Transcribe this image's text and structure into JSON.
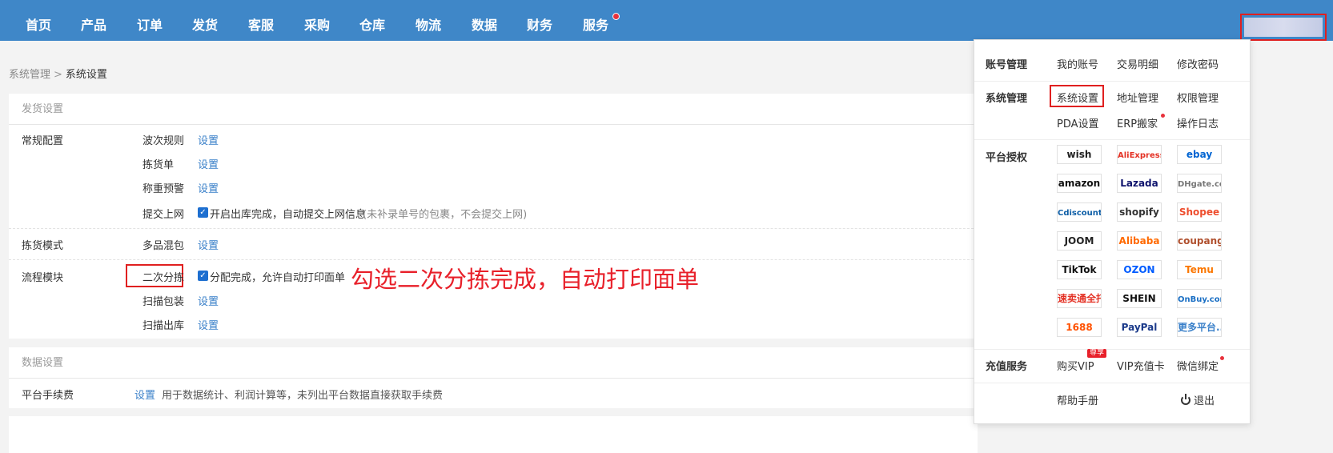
{
  "nav": {
    "items": [
      "首页",
      "产品",
      "订单",
      "发货",
      "客服",
      "采购",
      "仓库",
      "物流",
      "数据",
      "财务",
      "服务"
    ]
  },
  "breadcrumb": {
    "parent": "系统管理",
    "separator": ">",
    "current": "系统设置"
  },
  "shipping": {
    "header": "发货设置",
    "general": {
      "label": "常规配置",
      "items": [
        {
          "name": "波次规则",
          "action": "设置"
        },
        {
          "name": "拣货单",
          "action": "设置"
        },
        {
          "name": "称重预警",
          "action": "设置"
        }
      ],
      "submit": {
        "name": "提交上网",
        "checkbox_text": "开启出库完成，自动提交上网信息",
        "note": "(未补录单号的包裹，不会提交上网)"
      }
    },
    "picking": {
      "label": "拣货模式",
      "item": "多品混包",
      "action": "设置"
    },
    "flow": {
      "label": "流程模块",
      "sorting": {
        "name": "二次分拣",
        "checkbox_text": "分配完成，允许自动打印面单"
      },
      "items": [
        {
          "name": "扫描包装",
          "action": "设置"
        },
        {
          "name": "扫描出库",
          "action": "设置"
        }
      ]
    }
  },
  "annotation": "勾选二次分拣完成，自动打印面单",
  "data_settings": {
    "header": "数据设置",
    "fee": {
      "label": "平台手续费",
      "action": "设置",
      "desc": "用于数据统计、利润计算等，未列出平台数据直接获取手续费"
    }
  },
  "dropdown": {
    "account": {
      "label": "账号管理",
      "links": [
        "我的账号",
        "交易明细",
        "修改密码"
      ]
    },
    "system": {
      "label": "系统管理",
      "links": [
        "系统设置",
        "地址管理",
        "权限管理",
        "PDA设置",
        "ERP搬家",
        "操作日志"
      ]
    },
    "platforms": {
      "label": "平台授权",
      "logos": [
        {
          "name": "wish",
          "color": "#222222"
        },
        {
          "name": "AliExpress",
          "color": "#e43225"
        },
        {
          "name": "ebay",
          "color": "#0064d2"
        },
        {
          "name": "amazon",
          "color": "#111111"
        },
        {
          "name": "Lazada",
          "color": "#0f146d"
        },
        {
          "name": "DHgate.com",
          "color": "#777777"
        },
        {
          "name": "Cdiscount",
          "color": "#0d5ea6"
        },
        {
          "name": "shopify",
          "color": "#333333"
        },
        {
          "name": "Shopee",
          "color": "#ee4d2d"
        },
        {
          "name": "JOOM",
          "color": "#222222"
        },
        {
          "name": "Alibaba",
          "color": "#ff6a00"
        },
        {
          "name": "coupang",
          "color": "#b0502e"
        },
        {
          "name": "TikTok",
          "color": "#111111"
        },
        {
          "name": "OZON",
          "color": "#005bff"
        },
        {
          "name": "Temu",
          "color": "#fb7701"
        },
        {
          "name": "速卖通全托管",
          "color": "#e43225"
        },
        {
          "name": "SHEIN",
          "color": "#111111"
        },
        {
          "name": "OnBuy.com",
          "color": "#1a6fc4"
        },
        {
          "name": "1688",
          "color": "#ff5000"
        },
        {
          "name": "PayPal",
          "color": "#1b3a8a"
        },
        {
          "name": "更多平台...",
          "color": "#3a80c9"
        }
      ]
    },
    "recharge": {
      "label": "充值服务",
      "links": [
        "购买VIP",
        "VIP充值卡",
        "微信绑定"
      ],
      "badge": "尊享"
    },
    "help": "帮助手册",
    "logout": "退出"
  }
}
